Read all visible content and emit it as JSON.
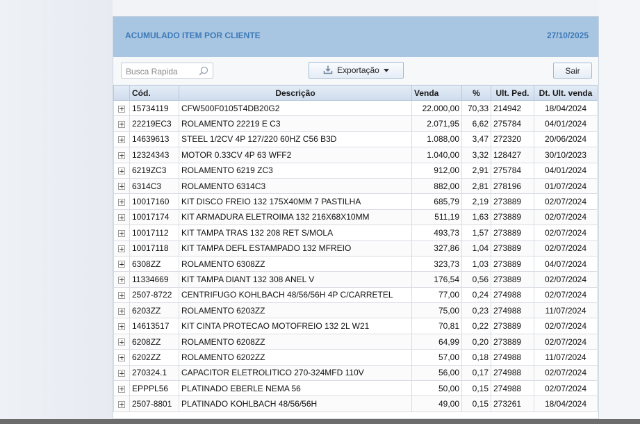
{
  "header": {
    "title": "ACUMULADO ITEM POR CLIENTE",
    "date": "27/10/2025"
  },
  "toolbar": {
    "search_placeholder": "Busca Rapida",
    "search_value": "",
    "export_label": "Exportação",
    "exit_label": "Sair"
  },
  "icons": {
    "search": "magnifier-icon",
    "export": "download-icon",
    "export_caret": "caret-down-icon",
    "expand": "plus-box-icon"
  },
  "colors": {
    "header_bg": "#a8c6e2",
    "header_text": "#3e7ab8"
  },
  "table": {
    "columns": [
      "Cód.",
      "Descrição",
      "Venda",
      "%",
      "Ult. Ped.",
      "Dt. Ult. venda"
    ],
    "rows": [
      [
        "15734119",
        "CFW500F0105T4DB20G2",
        "22.000,00",
        "70,33",
        "214942",
        "18/04/2024"
      ],
      [
        "22219EC3",
        "ROLAMENTO 22219 E C3",
        "2.071,95",
        "6,62",
        "275784",
        "04/01/2024"
      ],
      [
        "14639613",
        "STEEL 1/2CV 4P 127/220 60HZ C56 B3D",
        "1.088,00",
        "3,47",
        "272320",
        "20/06/2024"
      ],
      [
        "12324343",
        "MOTOR 0.33CV 4P 63 WFF2",
        "1.040,00",
        "3,32",
        "128427",
        "30/10/2023"
      ],
      [
        "6219ZC3",
        "ROLAMENTO 6219 ZC3",
        "912,00",
        "2,91",
        "275784",
        "04/01/2024"
      ],
      [
        "6314C3",
        "ROLAMENTO 6314C3",
        "882,00",
        "2,81",
        "278196",
        "01/07/2024"
      ],
      [
        "10017160",
        "KIT DISCO FREIO 132 175X40MM 7 PASTILHA",
        "685,79",
        "2,19",
        "273889",
        "02/07/2024"
      ],
      [
        "10017174",
        "KIT ARMADURA ELETROIMA 132 216X68X10MM",
        "511,19",
        "1,63",
        "273889",
        "02/07/2024"
      ],
      [
        "10017112",
        "KIT TAMPA TRAS 132 208 RET S/MOLA",
        "493,73",
        "1,57",
        "273889",
        "02/07/2024"
      ],
      [
        "10017118",
        "KIT TAMPA DEFL ESTAMPADO 132 MFREIO",
        "327,86",
        "1,04",
        "273889",
        "02/07/2024"
      ],
      [
        "6308ZZ",
        "ROLAMENTO 6308ZZ",
        "323,73",
        "1,03",
        "273889",
        "04/07/2024"
      ],
      [
        "11334669",
        "KIT TAMPA DIANT 132 308 ANEL V",
        "176,54",
        "0,56",
        "273889",
        "02/07/2024"
      ],
      [
        "2507-8722",
        "CENTRIFUGO KOHLBACH 48/56/56H 4P C/CARRETEL",
        "77,00",
        "0,24",
        "274988",
        "02/07/2024"
      ],
      [
        "6203ZZ",
        "ROLAMENTO 6203ZZ",
        "75,00",
        "0,23",
        "274988",
        "11/07/2024"
      ],
      [
        "14613517",
        "KIT CINTA PROTECAO MOTOFREIO 132 2L W21",
        "70,81",
        "0,22",
        "273889",
        "02/07/2024"
      ],
      [
        "6208ZZ",
        "ROLAMENTO 6208ZZ",
        "64,99",
        "0,20",
        "273889",
        "02/07/2024"
      ],
      [
        "6202ZZ",
        "ROLAMENTO 6202ZZ",
        "57,00",
        "0,18",
        "274988",
        "11/07/2024"
      ],
      [
        "270324.1",
        "CAPACITOR ELETROLITICO 270-324MFD 110V",
        "56,00",
        "0,17",
        "274988",
        "02/07/2024"
      ],
      [
        "EPPPL56",
        "PLATINADO EBERLE NEMA 56",
        "50,00",
        "0,15",
        "274988",
        "02/07/2024"
      ],
      [
        "2507-8801",
        "PLATINADO KOHLBACH 48/56/56H",
        "49,00",
        "0,15",
        "273261",
        "18/04/2024"
      ]
    ]
  }
}
